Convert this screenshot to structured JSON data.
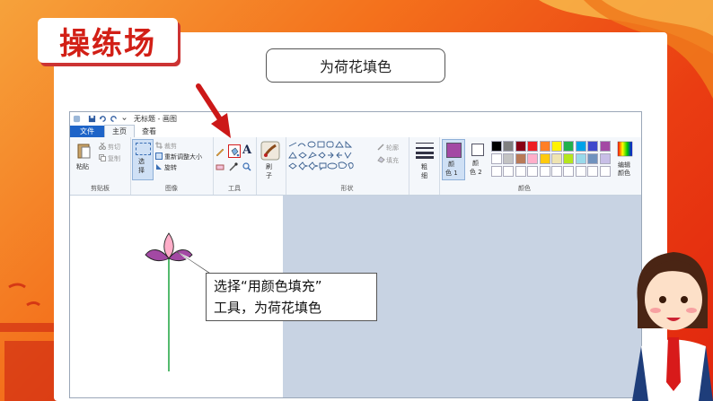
{
  "header": {
    "title": "操练场"
  },
  "task": {
    "label": "为荷花填色"
  },
  "paint": {
    "window_title": "无标题 - 画图",
    "tabs": {
      "file": "文件",
      "home": "主页",
      "view": "查看"
    },
    "clipboard": {
      "paste": "粘贴",
      "cut": "剪切",
      "copy": "复制",
      "label": "剪贴板"
    },
    "image": {
      "select": "选",
      "select2": "择",
      "crop": "裁剪",
      "resize": "重新调整大小",
      "rotate": "旋转",
      "label": "图像"
    },
    "tools": {
      "label": "工具"
    },
    "brush": {
      "l1": "刷",
      "l2": "子"
    },
    "shapes": {
      "outline": "轮廓",
      "fill": "填充",
      "label": "形状"
    },
    "size": {
      "l1": "粗",
      "l2": "细"
    },
    "color1": {
      "l1": "颜",
      "l2": "色 1"
    },
    "color2": {
      "l1": "颜",
      "l2": "色 2"
    },
    "colors": {
      "label": "颜色",
      "edit1": "编辑",
      "edit2": "颜色"
    },
    "palette_row1": [
      "#000000",
      "#7f7f7f",
      "#880015",
      "#ed1c24",
      "#ff7f27",
      "#fff200",
      "#22b14c",
      "#00a2e8",
      "#3f48cc",
      "#a349a4"
    ],
    "palette_row2": [
      "#ffffff",
      "#c3c3c3",
      "#b97a57",
      "#ffaec9",
      "#ffc90e",
      "#efe4b0",
      "#b5e61d",
      "#99d9ea",
      "#7092be",
      "#c8bfe7"
    ],
    "color1_value": "#a349a4"
  },
  "callout": {
    "line1": "选择“用颜色填充”",
    "line2": "工具，为荷花填色"
  },
  "colors": {
    "accent": "#d21f16",
    "arrow": "#cc1818"
  }
}
